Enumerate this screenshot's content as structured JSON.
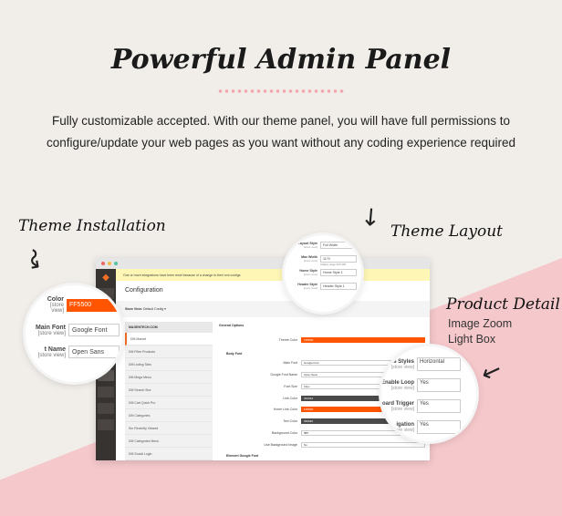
{
  "header": {
    "title": "Powerful Admin Panel",
    "description": "Fully customizable accepted. With our theme panel, you will have full permissions to configure/update your web pages as you want without any coding experience required"
  },
  "callouts": {
    "theme_installation": "Theme Installation",
    "theme_layout": "Theme Layout",
    "product_detail": "Product Detail",
    "product_features": [
      "Image Zoom",
      "Light Box"
    ]
  },
  "colors": {
    "accent": "#ff5500",
    "pink": "#f5c8cb",
    "background": "#f1eeea"
  },
  "admin": {
    "notice": "One or more integrations have been reset because of a change to their xml configs.",
    "page_title": "Configuration",
    "store_view_label": "Store View:",
    "store_view_value": "Default Config",
    "menu_header": "MAGENTECH.COM",
    "menu_items": [
      "DM Market",
      "DM Filter Products",
      "DM Listing Tabs",
      "DM Mega Menu",
      "DM Search Box",
      "DM Cart Quick Pro",
      "DM Categories",
      "Sm Recently Viewed",
      "DM Categories Menu",
      "DM Social Login"
    ],
    "section_general": "General Options",
    "section_body_font": "Body Font",
    "section_element_font": "Element Google Font",
    "fields": [
      {
        "label": "Theme Color",
        "value": "FF5500",
        "style": "orange"
      },
      {
        "label": "Main Font",
        "value": "Google Font",
        "style": ""
      },
      {
        "label": "Google Font Name",
        "value": "Open Sans",
        "style": ""
      },
      {
        "label": "Font Size",
        "value": "12px",
        "style": ""
      },
      {
        "label": "Link Color",
        "value": "444444",
        "style": "dark"
      },
      {
        "label": "Hover Link Color",
        "value": "FF5500",
        "style": "orange"
      },
      {
        "label": "Text Color",
        "value": "666666",
        "style": "dark"
      },
      {
        "label": "Background Color",
        "value": "ffffff",
        "style": ""
      },
      {
        "label": "Use Background Image",
        "value": "No",
        "style": ""
      }
    ]
  },
  "zoom_install": {
    "store_view": "[store view]",
    "fields": [
      {
        "label": "Color",
        "value": "FF5500"
      },
      {
        "label": "Main Font",
        "value": "Google Font"
      },
      {
        "label": "t Name",
        "value": "Open Sans"
      }
    ]
  },
  "zoom_layout": {
    "store_view": "[store view]",
    "fields": [
      {
        "label": "Layout Style",
        "value": "Full Width"
      },
      {
        "label": "Max Width",
        "value": "1170",
        "note": "Unit(px), range 1170-128"
      },
      {
        "label": "Home Style",
        "value": "Home Style 1"
      },
      {
        "label": "Header Style",
        "value": "Header Style 1"
      }
    ]
  },
  "zoom_product": {
    "store_view": "[store view]",
    "fields": [
      {
        "label": "umbs Styles",
        "value": "Horizontal"
      },
      {
        "label": "Enable Loop",
        "value": "Yes"
      },
      {
        "label": "yboard Trigger",
        "value": "Yes"
      },
      {
        "label": "igation",
        "value": "Yes"
      }
    ]
  }
}
